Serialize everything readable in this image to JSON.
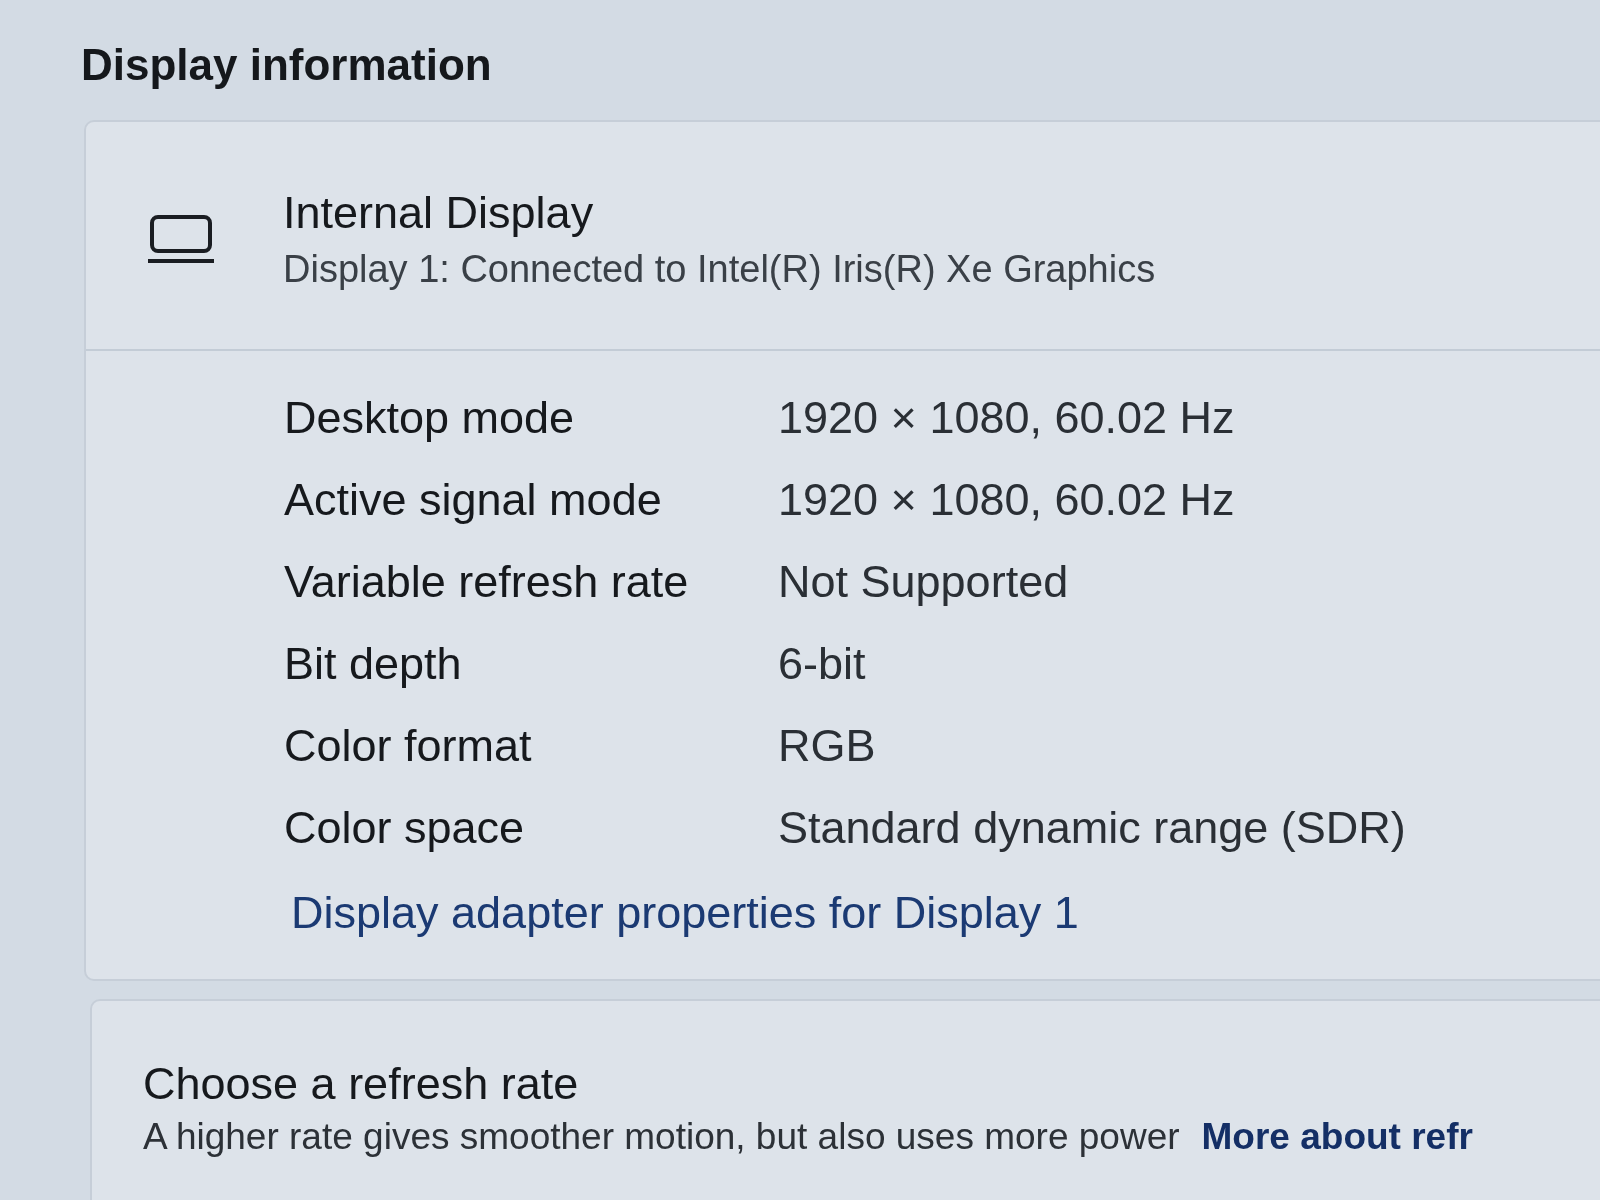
{
  "section_title": "Display information",
  "display": {
    "name": "Internal Display",
    "description": "Display 1: Connected to Intel(R) Iris(R) Xe Graphics"
  },
  "properties": [
    {
      "label": "Desktop mode",
      "value": "1920 × 1080, 60.02 Hz"
    },
    {
      "label": "Active signal mode",
      "value": "1920 × 1080, 60.02 Hz"
    },
    {
      "label": "Variable refresh rate",
      "value": "Not Supported"
    },
    {
      "label": "Bit depth",
      "value": "6-bit"
    },
    {
      "label": "Color format",
      "value": "RGB"
    },
    {
      "label": "Color space",
      "value": "Standard dynamic range (SDR)"
    }
  ],
  "adapter_link": "Display adapter properties for Display 1",
  "refresh_rate": {
    "title": "Choose a refresh rate",
    "description": "A higher rate gives smoother motion, but also uses more power",
    "link": "More about refr"
  }
}
